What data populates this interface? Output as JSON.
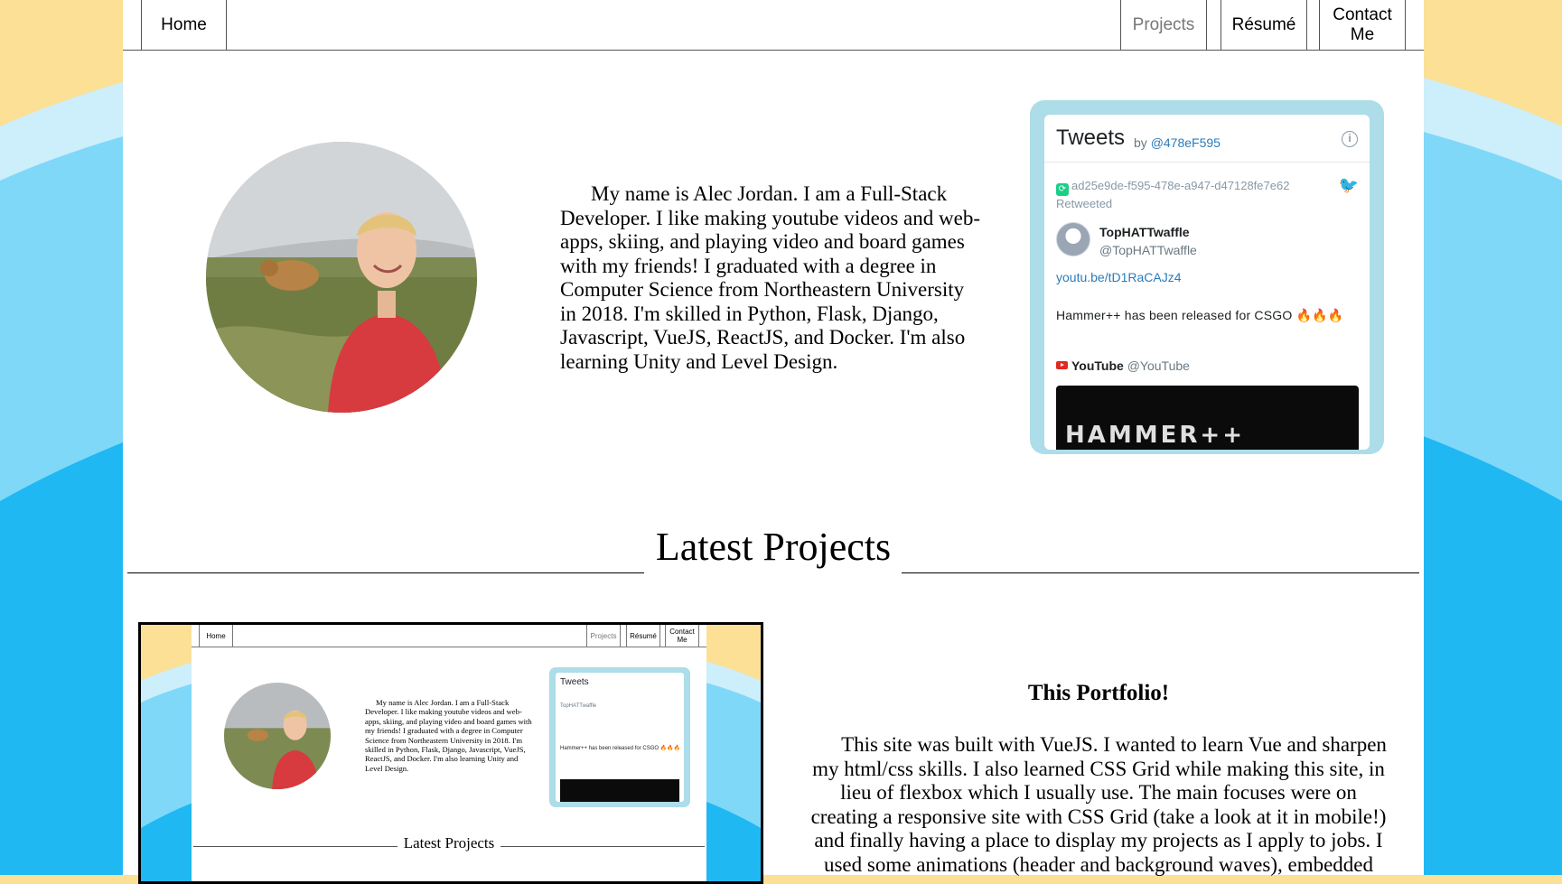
{
  "nav": {
    "home": "Home",
    "projects": "Projects",
    "resume": "Résumé",
    "contact": "Contact Me"
  },
  "bio": "My name is Alec Jordan. I am a Full-Stack Developer. I like making youtube videos and web-apps, skiing, and playing video and board games with my friends! I graduated with a degree in Computer Science from Northeastern University in 2018. I'm skilled in Python, Flask, Django, Javascript, VueJS, ReactJS, and Docker. I'm also learning Unity and Level Design.",
  "tweets": {
    "title": "Tweets",
    "by": "by",
    "handle": "@478eF595",
    "retweeter": "ad25e9de-f595-478e-a947-d47128fe7e62",
    "retweeted": "Retweeted",
    "author_name": "TopHATTwaffle",
    "author_handle": "@TopHATTwaffle",
    "link": "youtu.be/tD1RaCAJz4",
    "text": "Hammer++ has been released for CSGO 🔥🔥🔥",
    "card_source": "YouTube",
    "card_source_handle": "@YouTube",
    "media_text": "HAMMER++"
  },
  "latest_projects": {
    "title": "Latest Projects"
  },
  "project": {
    "title": "This Portfolio!",
    "description": "This site was built with VueJS. I wanted to learn Vue and sharpen my html/css skills. I also learned CSS Grid while making this site, in lieu of flexbox which I usually use. The main focuses were on creating a responsive site with CSS Grid (take a look at it in mobile!) and finally having a place to display my projects as I apply to jobs. I used some animations (header and background waves), embedded"
  },
  "colors": {
    "sand": "#fbe096",
    "sky_light": "#cdeefb",
    "sky_mid": "#7fd8f8",
    "sky_deep": "#1fb8f2",
    "tweet_frame": "#acdde8"
  }
}
